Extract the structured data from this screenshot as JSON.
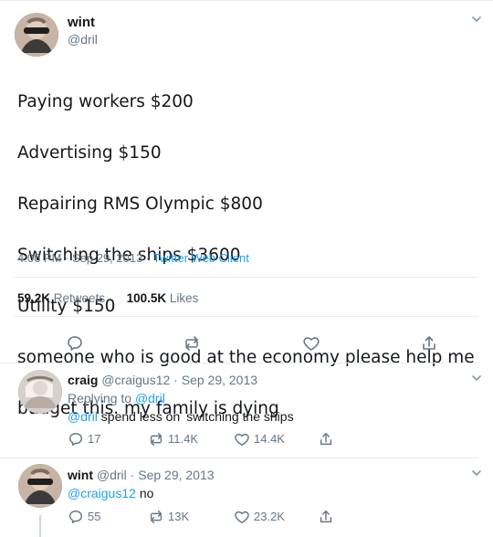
{
  "main_tweet": {
    "display_name": "wint",
    "handle": "@dril",
    "text_lines": [
      "Paying workers $200",
      " Advertising $150",
      "Repairing RMS Olympic $800",
      " Switching the ships $3600",
      "Utility $150",
      "someone who is good at the economy please help me",
      "budget this. my family is dying"
    ],
    "timestamp": "4:06 PM · Sep 29, 2013 · ",
    "client": "Twitter Web Client",
    "retweets": "59.2K",
    "retweets_label": "Retweets",
    "likes": "100.5K",
    "likes_label": "Likes",
    "icons": {
      "reply": "reply-icon",
      "retweet": "retweet-icon",
      "like": "like-icon",
      "share": "share-icon",
      "menu": "chevron-down-icon"
    }
  },
  "replies": [
    {
      "display_name": "craig",
      "handle": "@craigus12",
      "date": "Sep 29, 2013",
      "replying_to_prefix": "Replying to ",
      "replying_to": "@dril",
      "mention": "@dril",
      "text_a": "spend less on",
      "text_b": "switching the ships",
      "counts": {
        "reply": "17",
        "retweet": "11.4K",
        "like": "14.4K"
      }
    },
    {
      "display_name": "wint",
      "handle": "@dril",
      "date": "Sep 29, 2013",
      "mention": "@craigus12",
      "text": "no",
      "counts": {
        "reply": "55",
        "retweet": "13K",
        "like": "23.2K"
      }
    }
  ],
  "colors": {
    "text": "#14171a",
    "muted": "#657786",
    "blue": "#1da1f2",
    "divider": "#e6ecf0"
  }
}
